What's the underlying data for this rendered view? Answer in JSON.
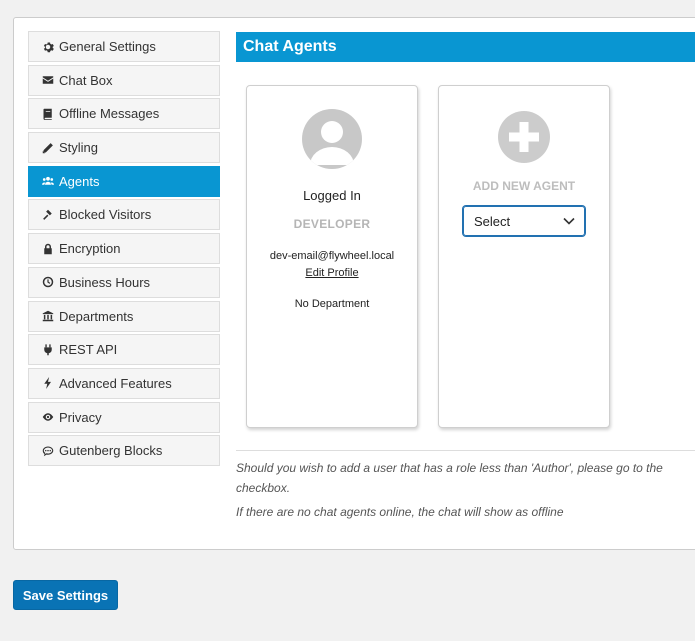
{
  "sidebar": {
    "items": [
      {
        "label": "General Settings",
        "icon": "gear-icon"
      },
      {
        "label": "Chat Box",
        "icon": "envelope-icon"
      },
      {
        "label": "Offline Messages",
        "icon": "book-icon"
      },
      {
        "label": "Styling",
        "icon": "pencil-icon"
      },
      {
        "label": "Agents",
        "icon": "users-icon"
      },
      {
        "label": "Blocked Visitors",
        "icon": "gavel-icon"
      },
      {
        "label": "Encryption",
        "icon": "lock-icon"
      },
      {
        "label": "Business Hours",
        "icon": "clock-icon"
      },
      {
        "label": "Departments",
        "icon": "university-icon"
      },
      {
        "label": "REST API",
        "icon": "plug-icon"
      },
      {
        "label": "Advanced Features",
        "icon": "bolt-icon"
      },
      {
        "label": "Privacy",
        "icon": "eye-icon"
      },
      {
        "label": "Gutenberg Blocks",
        "icon": "comment-icon"
      }
    ],
    "active_index": 4
  },
  "header": {
    "title": "Chat Agents"
  },
  "agent_card": {
    "name": "Logged In",
    "role": "DEVELOPER",
    "email": "dev-email@flywheel.local",
    "edit_link": "Edit Profile",
    "department": "No Department"
  },
  "add_agent": {
    "label": "ADD NEW AGENT",
    "select_value": "Select"
  },
  "notes": {
    "line1": "Should you wish to add a user that has a role less than 'Author', please go to the",
    "line1b": "checkbox.",
    "line2": "If there are no chat agents online, the chat will show as offline"
  },
  "footer": {
    "save_label": "Save Settings"
  },
  "colors": {
    "accent": "#0996d2",
    "save_button": "#0973b5",
    "select_border": "#2271b1"
  }
}
